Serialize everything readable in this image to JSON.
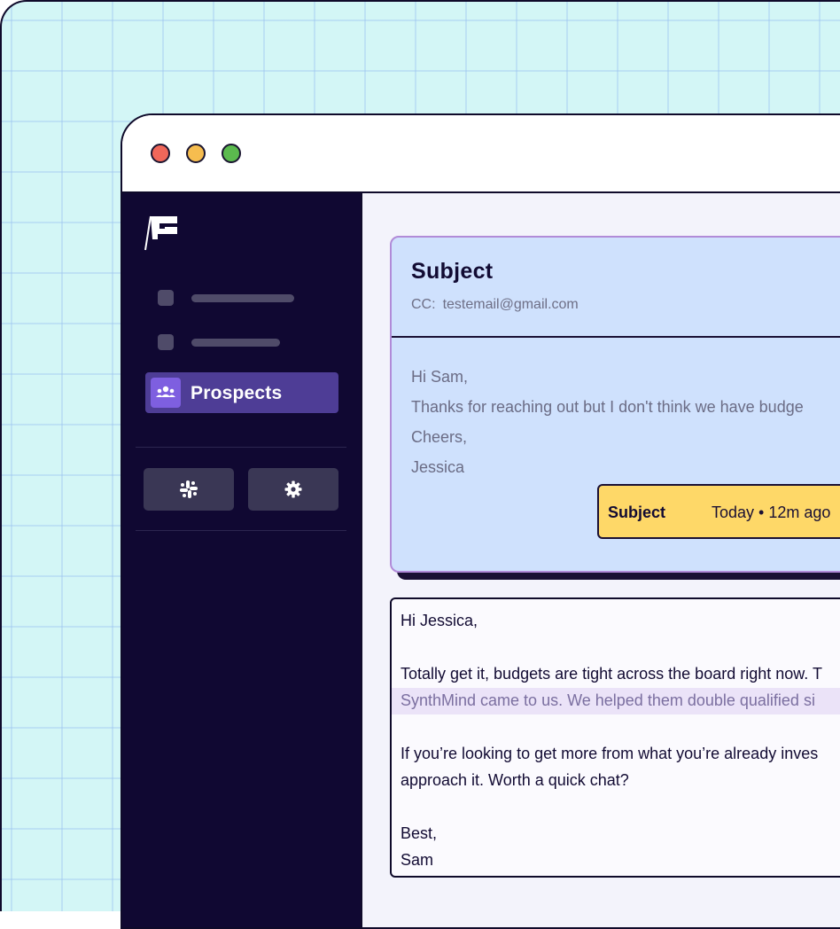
{
  "app": {
    "brand_logo": "flag-logo"
  },
  "window": {
    "controls": [
      "close",
      "minimize",
      "maximize"
    ]
  },
  "sidebar": {
    "nav_items": [
      {
        "type": "placeholder"
      },
      {
        "type": "placeholder"
      },
      {
        "label": "Prospects",
        "icon": "people-icon",
        "active": true
      }
    ],
    "buttons": [
      {
        "icon": "slack-icon"
      },
      {
        "icon": "gear-icon"
      }
    ]
  },
  "email": {
    "subject": "Subject",
    "cc_label": "CC:",
    "cc_value": "testemail@gmail.com",
    "body": [
      "Hi Sam,",
      "Thanks for reaching out but I don't think we have budge",
      "Cheers,",
      "Jessica"
    ],
    "tag": {
      "subject": "Subject",
      "time": "Today • 12m ago"
    }
  },
  "reply": {
    "greeting": "Hi Jessica,",
    "line1": "Totally get it, budgets are tight across the board right now. T",
    "line2_highlighted": "SynthMind came to us. We helped them double qualified si",
    "line3": "If you’re looking to get more from what you’re already inves",
    "line4": "approach it. Worth a quick chat?",
    "signoff": "Best,",
    "name": "Sam"
  },
  "colors": {
    "backdrop": "#d3f6f6",
    "sidebar": "#100832",
    "accent": "#4e3d96",
    "card": "#cfe1fd",
    "tag": "#fed868"
  }
}
